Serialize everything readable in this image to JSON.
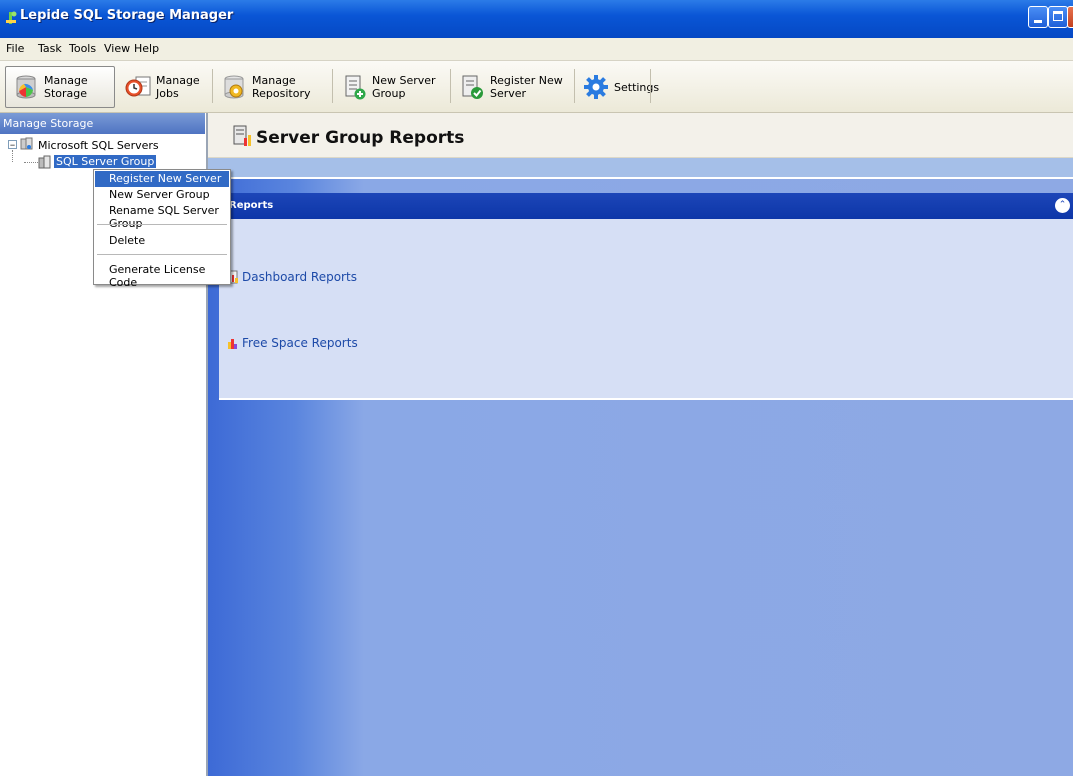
{
  "window": {
    "title": "Lepide SQL Storage Manager"
  },
  "menu": [
    "File",
    "Task",
    "Tools",
    "View",
    "Help"
  ],
  "toolbar": {
    "manage_storage": "Manage Storage",
    "manage_jobs": "Manage Jobs",
    "manage_repository": "Manage Repository",
    "new_server_group": "New Server Group",
    "register_new_server": "Register New Server",
    "settings": "Settings"
  },
  "left_panel": {
    "header": "Manage Storage",
    "tree": {
      "root_label": "Microsoft SQL Servers",
      "child_label": "SQL Server Group"
    }
  },
  "context_menu": {
    "register_new_server": "Register New Server",
    "new_server_group": "New Server Group",
    "rename_group": "Rename SQL Server Group",
    "delete": "Delete",
    "generate_license": "Generate License Code"
  },
  "main": {
    "title": "Server Group Reports",
    "reports_header": "Reports",
    "links": {
      "dashboard": "Dashboard Reports",
      "free_space": "Free Space Reports"
    }
  },
  "colors": {
    "titlebar": "#0a56d6",
    "selection": "#316ac5",
    "reports_header": "#1d46b8",
    "link": "#1d4aa8"
  }
}
